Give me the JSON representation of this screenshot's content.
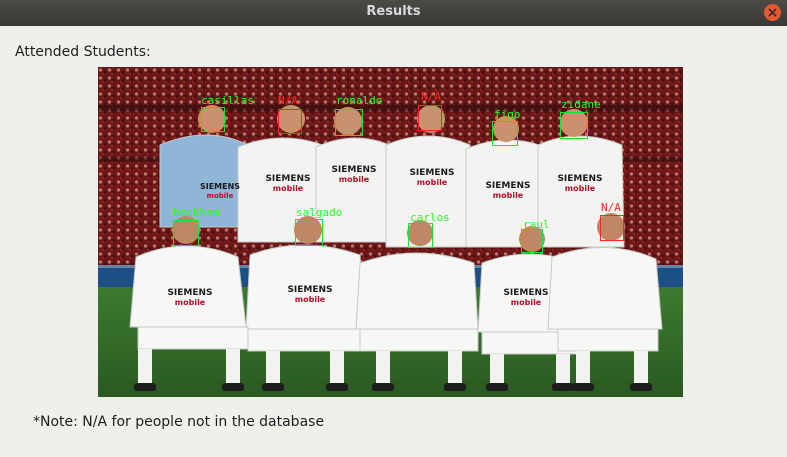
{
  "window": {
    "title": "Results"
  },
  "heading": "Attended Students:",
  "note": "*Note: N/A for people not in the database",
  "shirt_text": {
    "brand": "SIEMENS",
    "sub": "mobile"
  },
  "colors": {
    "known_box": "#17e52b",
    "unknown_box": "#ff2a1a",
    "close_button": "#e25a31"
  },
  "faces": [
    {
      "label": "casillas",
      "known": true
    },
    {
      "label": "N/A",
      "known": false
    },
    {
      "label": "ronaldo",
      "known": true
    },
    {
      "label": "N/A",
      "known": false
    },
    {
      "label": "figo",
      "known": true
    },
    {
      "label": "zidane",
      "known": true
    },
    {
      "label": "beckham",
      "known": true
    },
    {
      "label": "salgado",
      "known": true
    },
    {
      "label": "carlos",
      "known": true
    },
    {
      "label": "raul",
      "known": true
    },
    {
      "label": "N/A",
      "known": false
    }
  ]
}
